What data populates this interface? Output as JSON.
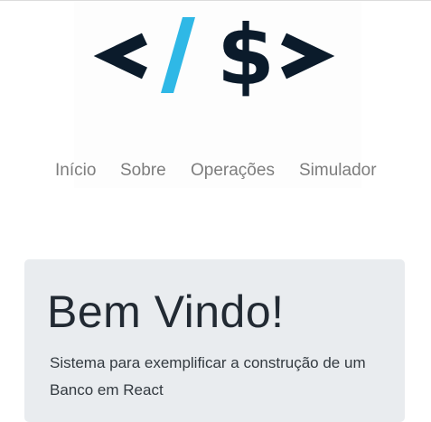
{
  "logo": {
    "alt": "</$>",
    "colors": {
      "dark": "#0b1b2b",
      "slash": "#2fb8e6"
    }
  },
  "nav": {
    "items": [
      {
        "label": "Início"
      },
      {
        "label": "Sobre"
      },
      {
        "label": "Operações"
      },
      {
        "label": "Simulador"
      }
    ]
  },
  "jumbotron": {
    "title": "Bem Vindo!",
    "description": "Sistema para exemplificar a construção de um Banco em React"
  }
}
